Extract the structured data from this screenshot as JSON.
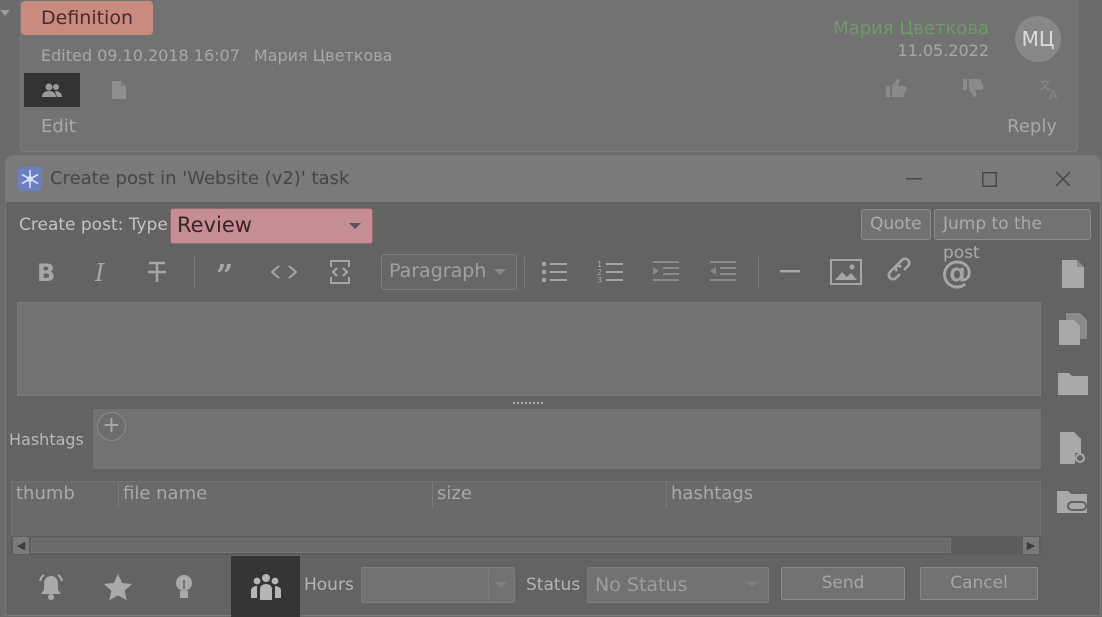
{
  "post": {
    "type_badge": "Definition",
    "edited_label": "Edited 09.10.2018 16:07",
    "edited_by": "Мария Цветкова",
    "author_name": "Мария Цветкова",
    "author_date": "11.05.2022",
    "avatar_initials": "МЦ",
    "edit_label": "Edit",
    "reply_label": "Reply"
  },
  "dialog": {
    "title": "Create post in 'Website (v2)' task",
    "type_label": "Create post: Type -",
    "type_value": "Review",
    "quote_label": "Quote",
    "jump_label": "Jump to the post",
    "paragraph_value": "Paragraph",
    "hashtags_label": "Hashtags",
    "table_headers": [
      "thumb",
      "file name",
      "size",
      "hashtags"
    ],
    "hours_label": "Hours",
    "status_label": "Status",
    "status_value": "No Status",
    "send_label": "Send",
    "cancel_label": "Cancel"
  },
  "icons": {
    "post_row": [
      "people-icon",
      "document-icon",
      "thumb-up-icon",
      "thumb-down-icon",
      "translate-icon"
    ],
    "toolbar": [
      "bold-icon",
      "italic-icon",
      "strikethrough-icon",
      "quote-icon",
      "code-icon",
      "code-block-icon",
      "bullet-list-icon",
      "numbered-list-icon",
      "indent-icon",
      "outdent-icon",
      "horizontal-rule-icon",
      "image-icon",
      "link-icon",
      "mention-icon"
    ],
    "side": [
      "new-document-icon",
      "copy-documents-icon",
      "folder-icon",
      "document-link-icon",
      "folder-link-icon"
    ],
    "bottom": [
      "bell-icon",
      "star-icon",
      "lightbulb-icon",
      "team-icon"
    ]
  },
  "colors": {
    "badge_bg": "#c98a80",
    "type_select_bg": "#c58e95",
    "author_name": "#6f9a6a"
  }
}
